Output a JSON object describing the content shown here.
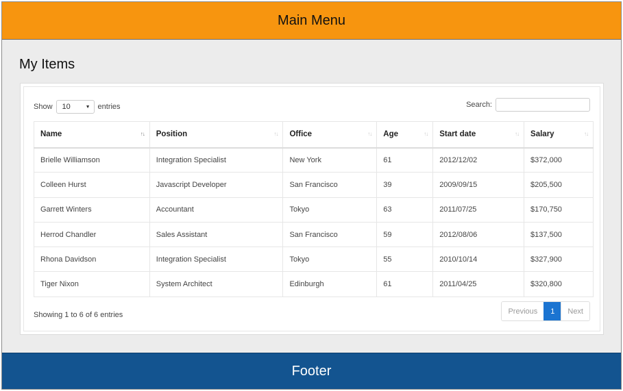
{
  "header": {
    "title": "Main Menu"
  },
  "page": {
    "title": "My Items"
  },
  "table_controls": {
    "show_label": "Show",
    "page_length": "10",
    "entries_label": "entries",
    "search_label": "Search:",
    "search_value": ""
  },
  "table": {
    "columns": [
      "Name",
      "Position",
      "Office",
      "Age",
      "Start date",
      "Salary"
    ],
    "sorted_column": "Name",
    "rows": [
      [
        "Brielle Williamson",
        "Integration Specialist",
        "New York",
        "61",
        "2012/12/02",
        "$372,000"
      ],
      [
        "Colleen Hurst",
        "Javascript Developer",
        "San Francisco",
        "39",
        "2009/09/15",
        "$205,500"
      ],
      [
        "Garrett Winters",
        "Accountant",
        "Tokyo",
        "63",
        "2011/07/25",
        "$170,750"
      ],
      [
        "Herrod Chandler",
        "Sales Assistant",
        "San Francisco",
        "59",
        "2012/08/06",
        "$137,500"
      ],
      [
        "Rhona Davidson",
        "Integration Specialist",
        "Tokyo",
        "55",
        "2010/10/14",
        "$327,900"
      ],
      [
        "Tiger Nixon",
        "System Architect",
        "Edinburgh",
        "61",
        "2011/04/25",
        "$320,800"
      ]
    ]
  },
  "table_info": "Showing 1 to 6 of 6 entries",
  "pagination": {
    "previous": "Previous",
    "current_page": "1",
    "next": "Next"
  },
  "footer": {
    "title": "Footer"
  },
  "colors": {
    "header_bg": "#f7950f",
    "footer_bg": "#135490",
    "page_bg": "#ececec",
    "active_page": "#1b74d1"
  },
  "icons": {
    "page_length_dropdown": "caret-down-icon",
    "column_sort": "sort-icon"
  }
}
